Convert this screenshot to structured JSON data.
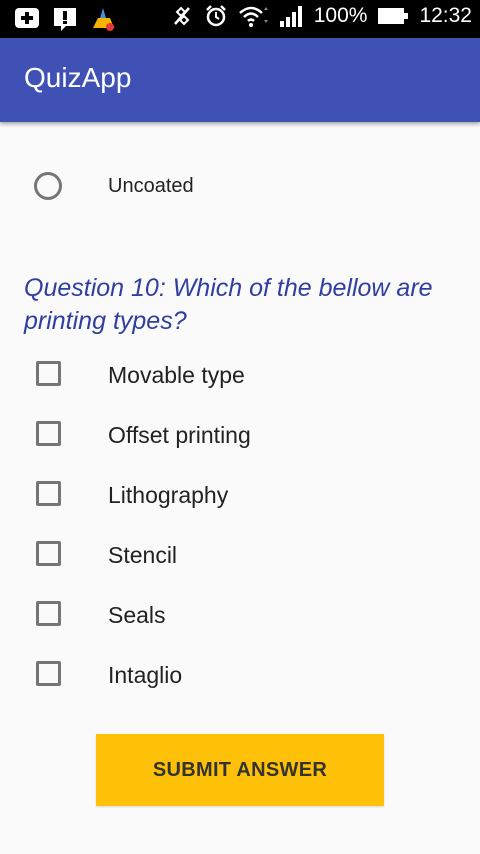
{
  "status_bar": {
    "battery_percent": "100%",
    "time": "12:32",
    "icons": [
      "add-notification-icon",
      "alert-icon",
      "cleaner-app-icon",
      "vibrate-icon",
      "alarm-icon",
      "wifi-icon",
      "signal-icon",
      "battery-icon"
    ]
  },
  "app_bar": {
    "title": "QuizApp"
  },
  "previous_question": {
    "option": {
      "label": "Uncoated",
      "selected": false
    }
  },
  "question10": {
    "text": "Question 10: Which of the bellow are printing types?",
    "options": [
      {
        "label": "Movable type",
        "checked": false
      },
      {
        "label": "Offset printing",
        "checked": false
      },
      {
        "label": "Lithography",
        "checked": false
      },
      {
        "label": "Stencil",
        "checked": false
      },
      {
        "label": "Seals",
        "checked": false
      },
      {
        "label": "Intaglio",
        "checked": false
      }
    ]
  },
  "submit": {
    "label": "SUBMIT ANSWER"
  },
  "colors": {
    "app_bar": "#3f51b5",
    "question_text": "#303f9f",
    "button": "#ffc107"
  }
}
